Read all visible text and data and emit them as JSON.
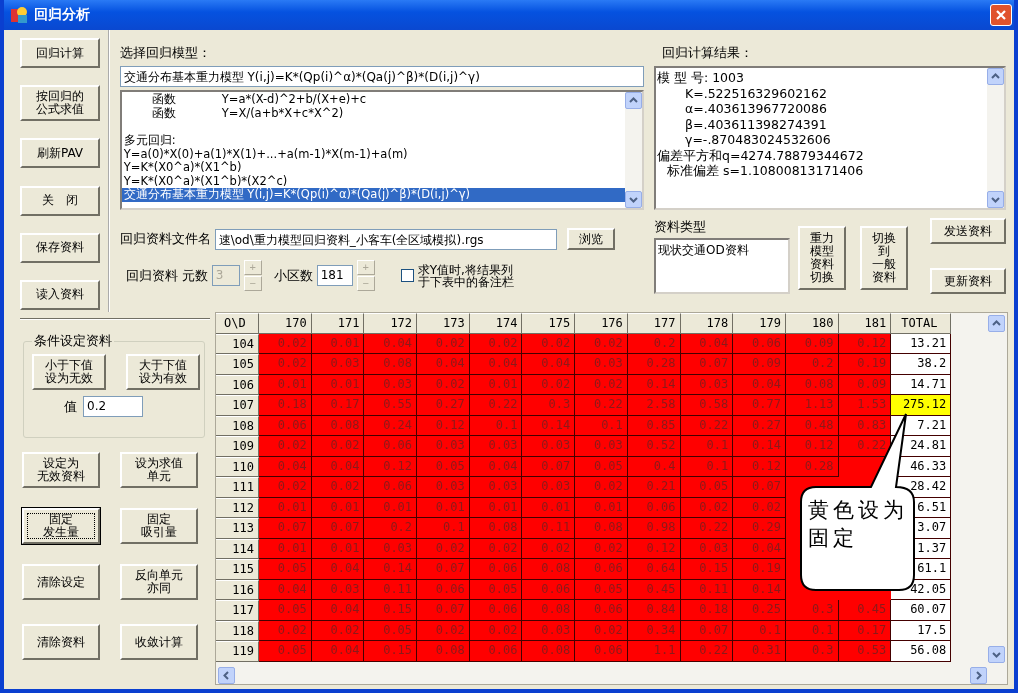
{
  "window": {
    "title": "回归分析"
  },
  "left_buttons": [
    {
      "lines": [
        "回归计算"
      ]
    },
    {
      "lines": [
        "按回归的",
        "公式求值"
      ]
    },
    {
      "lines": [
        "刷新PAV"
      ]
    },
    {
      "lines": [
        "关　闭"
      ]
    },
    {
      "lines": [
        "保存资料"
      ]
    },
    {
      "lines": [
        "读入资料"
      ]
    }
  ],
  "conditions": {
    "title": "条件设定资料",
    "buttons": [
      {
        "lines": [
          "小于下值",
          "设为无效"
        ]
      },
      {
        "lines": [
          "大于下值",
          "设为有效"
        ]
      }
    ],
    "value_label": "值",
    "value": "0.2"
  },
  "lower_buttons": [
    {
      "lines": [
        "设定为",
        "无效资料"
      ],
      "focused": false
    },
    {
      "lines": [
        "设为求值",
        "单元"
      ],
      "focused": false
    },
    {
      "lines": [
        "固定",
        "发生量"
      ],
      "focused": true
    },
    {
      "lines": [
        "固定",
        "吸引量"
      ],
      "focused": false
    },
    {
      "lines": [
        "清除设定"
      ],
      "focused": false
    },
    {
      "lines": [
        "反向单元",
        "亦同"
      ],
      "focused": false
    },
    {
      "lines": [
        "清除资料"
      ],
      "focused": false
    },
    {
      "lines": [
        "收敛计算"
      ],
      "focused": false
    }
  ],
  "model": {
    "label": "选择回归模型：",
    "combo_value": "交通分布基本重力模型 Y(i,j)=K*(Qp(i)^α)*(Qa(j)^β)*(D(i,j)^γ)",
    "list": [
      {
        "kind": "function",
        "label": "函数",
        "formula": "Y=a*(X-d)^2+b/(X+e)+c",
        "selected": false
      },
      {
        "kind": "function",
        "label": "函数",
        "formula": "Y=X/(a+b*X+c*X^2)",
        "selected": false
      },
      {
        "kind": "heading",
        "text": "多元回归:",
        "selected": false
      },
      {
        "kind": "formula",
        "text": "Y=a(0)*X(0)+a(1)*X(1)+...+a(m-1)*X(m-1)+a(m)",
        "selected": false
      },
      {
        "kind": "formula",
        "text": "Y=K*(X0^a)*(X1^b)",
        "selected": false
      },
      {
        "kind": "formula",
        "text": "Y=K*(X0^a)*(X1^b)*(X2^c)",
        "selected": false
      },
      {
        "kind": "formula",
        "text": "交通分布基本重力模型 Y(i,j)=K*(Qp(i)^α)*(Qa(j)^β)*(D(i,j)^γ)",
        "selected": true
      }
    ]
  },
  "file": {
    "label": "回归资料文件名",
    "value": "速\\od\\重力模型回归资料_小客车(全区域模拟).rgs",
    "browse": "浏览"
  },
  "params": {
    "label": "回归资料",
    "count_label": "元数",
    "count": "3",
    "count_disabled": true,
    "count_spin": {
      "up": "+",
      "down": "−"
    },
    "zones_label": "小区数",
    "zones": "181",
    "zones_spin": {
      "up": "+",
      "down": "−"
    }
  },
  "remark_checkbox": {
    "lines": [
      "求Y值时,将结果列",
      "于下表中的备注栏"
    ],
    "checked": false
  },
  "results": {
    "label": "回归计算结果：",
    "lines": [
      {
        "kind": "main",
        "text": "模 型 号: 1003"
      },
      {
        "kind": "param",
        "text": "K=.522516329602162"
      },
      {
        "kind": "param",
        "text": "α=.403613967720086"
      },
      {
        "kind": "param",
        "text": "β=.403611398274391"
      },
      {
        "kind": "param",
        "text": "γ=-.870483024532606"
      },
      {
        "kind": "main",
        "text": "偏差平方和q=4274.78879344672"
      },
      {
        "kind": "sub",
        "text": "标准偏差 s=1.10800813171406"
      }
    ]
  },
  "data_type": {
    "label": "资料类型",
    "value": "现状交通OD资料"
  },
  "side_buttons": [
    {
      "lines": [
        "重力",
        "模型",
        "资料",
        "切换"
      ]
    },
    {
      "lines": [
        "切换",
        "到",
        "一般",
        "资料"
      ]
    }
  ],
  "action_buttons": [
    {
      "label": "发送资料"
    },
    {
      "label": "更新资料"
    }
  ],
  "table": {
    "corner": "O\\D",
    "columns": [
      "170",
      "171",
      "172",
      "173",
      "174",
      "175",
      "176",
      "177",
      "178",
      "179",
      "180",
      "181"
    ],
    "total_label": "TOTAL",
    "rows": [
      {
        "id": "104",
        "cells": [
          "0.02",
          "0.01",
          "0.04",
          "0.02",
          "0.02",
          "0.02",
          "0.02",
          "0.2",
          "0.04",
          "0.06",
          "0.09",
          "0.12"
        ],
        "total": "13.21",
        "fixed": false
      },
      {
        "id": "105",
        "cells": [
          "0.02",
          "0.03",
          "0.08",
          "0.04",
          "0.04",
          "0.04",
          "0.03",
          "0.28",
          "0.07",
          "0.09",
          "0.2",
          "0.19"
        ],
        "total": "38.2",
        "fixed": false
      },
      {
        "id": "106",
        "cells": [
          "0.01",
          "0.01",
          "0.03",
          "0.02",
          "0.01",
          "0.02",
          "0.02",
          "0.14",
          "0.03",
          "0.04",
          "0.08",
          "0.09"
        ],
        "total": "14.71",
        "fixed": false
      },
      {
        "id": "107",
        "cells": [
          "0.18",
          "0.17",
          "0.55",
          "0.27",
          "0.22",
          "0.3",
          "0.22",
          "2.58",
          "0.58",
          "0.77",
          "1.13",
          "1.53"
        ],
        "total": "275.12",
        "fixed": true
      },
      {
        "id": "108",
        "cells": [
          "0.06",
          "0.08",
          "0.24",
          "0.12",
          "0.1",
          "0.14",
          "0.1",
          "0.85",
          "0.22",
          "0.27",
          "0.48",
          "0.83"
        ],
        "total": "7.21",
        "fixed": false
      },
      {
        "id": "109",
        "cells": [
          "0.02",
          "0.02",
          "0.06",
          "0.03",
          "0.03",
          "0.03",
          "0.03",
          "0.52",
          "0.1",
          "0.14",
          "0.12",
          "0.22"
        ],
        "total": "24.81",
        "fixed": false
      },
      {
        "id": "110",
        "cells": [
          "0.04",
          "0.04",
          "0.12",
          "0.05",
          "0.04",
          "0.07",
          "0.05",
          "0.4",
          "0.1",
          "0.12",
          "0.28",
          null
        ],
        "total": "46.33",
        "fixed": false
      },
      {
        "id": "111",
        "cells": [
          "0.02",
          "0.02",
          "0.06",
          "0.03",
          "0.03",
          "0.03",
          "0.02",
          "0.21",
          "0.05",
          "0.07",
          null,
          null
        ],
        "total": "28.42",
        "fixed": false
      },
      {
        "id": "112",
        "cells": [
          "0.01",
          "0.01",
          "0.01",
          "0.01",
          "0.01",
          "0.01",
          "0.01",
          "0.06",
          "0.02",
          "0.02",
          null,
          null
        ],
        "total": "6.51",
        "fixed": false
      },
      {
        "id": "113",
        "cells": [
          "0.07",
          "0.07",
          "0.2",
          "0.1",
          "0.08",
          "0.11",
          "0.08",
          "0.98",
          "0.22",
          "0.29",
          null,
          null
        ],
        "total": "3.07",
        "fixed": false
      },
      {
        "id": "114",
        "cells": [
          "0.01",
          "0.01",
          "0.03",
          "0.02",
          "0.02",
          "0.02",
          "0.02",
          "0.12",
          "0.03",
          "0.04",
          null,
          null
        ],
        "total": "1.37",
        "fixed": false
      },
      {
        "id": "115",
        "cells": [
          "0.05",
          "0.04",
          "0.14",
          "0.07",
          "0.06",
          "0.08",
          "0.06",
          "0.64",
          "0.15",
          "0.19",
          null,
          null
        ],
        "total": "61.1",
        "fixed": false
      },
      {
        "id": "116",
        "cells": [
          "0.04",
          "0.03",
          "0.11",
          "0.06",
          "0.05",
          "0.06",
          "0.05",
          "0.45",
          "0.11",
          "0.14",
          null,
          null
        ],
        "total": "42.05",
        "fixed": false
      },
      {
        "id": "117",
        "cells": [
          "0.05",
          "0.04",
          "0.15",
          "0.07",
          "0.06",
          "0.08",
          "0.06",
          "0.84",
          "0.18",
          "0.25",
          "0.3",
          "0.45"
        ],
        "total": "60.07",
        "fixed": false
      },
      {
        "id": "118",
        "cells": [
          "0.02",
          "0.02",
          "0.05",
          "0.02",
          "0.02",
          "0.03",
          "0.02",
          "0.34",
          "0.07",
          "0.1",
          "0.1",
          "0.17"
        ],
        "total": "17.5",
        "fixed": false
      },
      {
        "id": "119",
        "cells": [
          "0.05",
          "0.04",
          "0.15",
          "0.08",
          "0.06",
          "0.08",
          "0.06",
          "1.1",
          "0.22",
          "0.31",
          "0.3",
          "0.53"
        ],
        "total": "56.08",
        "fixed": false
      }
    ]
  },
  "callout": {
    "text": "黄色设为固定"
  }
}
